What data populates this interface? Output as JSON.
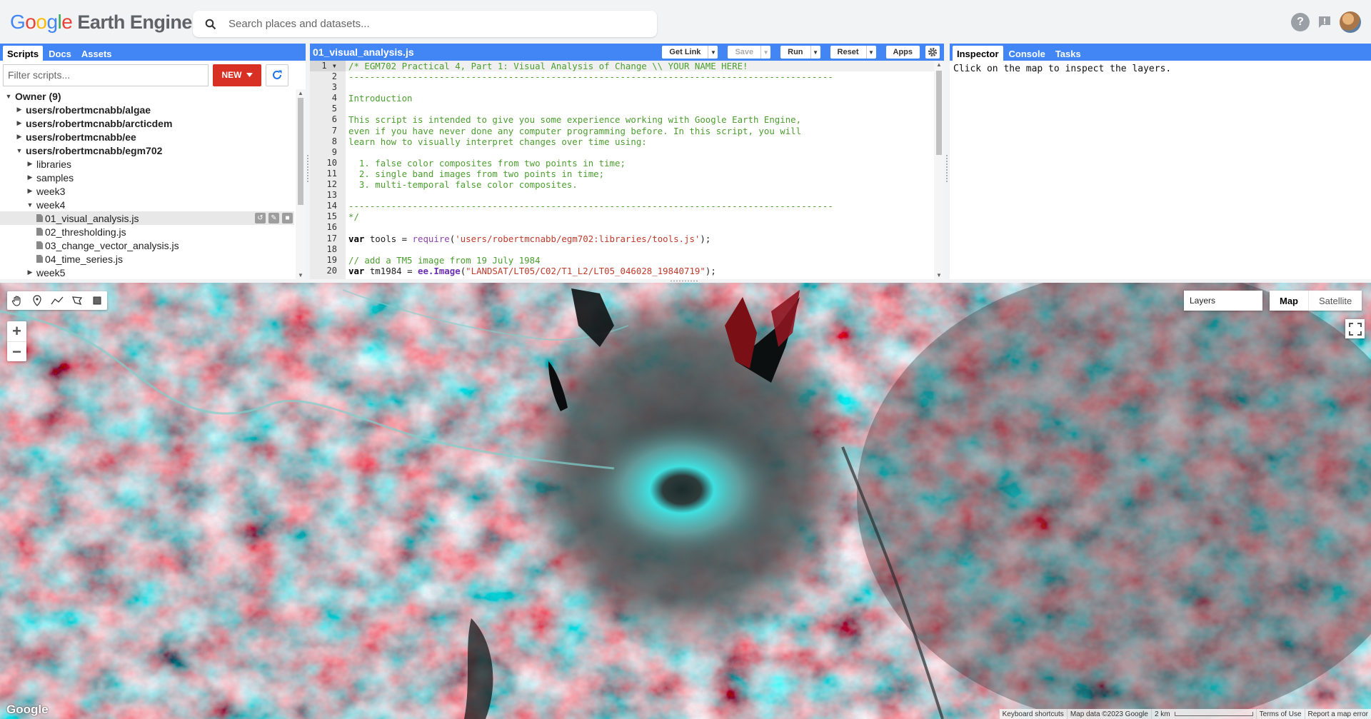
{
  "header": {
    "logo_letters": [
      "G",
      "o",
      "o",
      "g",
      "l",
      "e"
    ],
    "logo_product": "Earth Engine",
    "search_placeholder": "Search places and datasets..."
  },
  "left_panel": {
    "tabs": [
      {
        "label": "Scripts",
        "active": true
      },
      {
        "label": "Docs",
        "active": false
      },
      {
        "label": "Assets",
        "active": false
      }
    ],
    "filter_placeholder": "Filter scripts...",
    "new_label": "NEW",
    "tree": [
      {
        "label": "Owner (9)",
        "depth": 0,
        "expanded": true,
        "bold": true,
        "type": "folder"
      },
      {
        "label": "users/robertmcnabb/algae",
        "depth": 1,
        "expanded": false,
        "bold": true,
        "type": "folder"
      },
      {
        "label": "users/robertmcnabb/arcticdem",
        "depth": 1,
        "expanded": false,
        "bold": true,
        "type": "folder"
      },
      {
        "label": "users/robertmcnabb/ee",
        "depth": 1,
        "expanded": false,
        "bold": true,
        "type": "folder"
      },
      {
        "label": "users/robertmcnabb/egm702",
        "depth": 1,
        "expanded": true,
        "bold": true,
        "type": "folder"
      },
      {
        "label": "libraries",
        "depth": 2,
        "expanded": false,
        "bold": false,
        "type": "folder"
      },
      {
        "label": "samples",
        "depth": 2,
        "expanded": false,
        "bold": false,
        "type": "folder"
      },
      {
        "label": "week3",
        "depth": 2,
        "expanded": false,
        "bold": false,
        "type": "folder"
      },
      {
        "label": "week4",
        "depth": 2,
        "expanded": true,
        "bold": false,
        "type": "folder"
      },
      {
        "label": "01_visual_analysis.js",
        "depth": 3,
        "type": "file",
        "selected": true
      },
      {
        "label": "02_thresholding.js",
        "depth": 3,
        "type": "file"
      },
      {
        "label": "03_change_vector_analysis.js",
        "depth": 3,
        "type": "file"
      },
      {
        "label": "04_time_series.js",
        "depth": 3,
        "type": "file"
      },
      {
        "label": "week5",
        "depth": 2,
        "expanded": false,
        "bold": false,
        "type": "folder"
      }
    ]
  },
  "editor": {
    "title": "01_visual_analysis.js",
    "buttons": [
      {
        "label": "Get Link",
        "dropdown": true,
        "disabled": false
      },
      {
        "label": "Save",
        "dropdown": true,
        "disabled": true
      },
      {
        "label": "Run",
        "dropdown": true,
        "disabled": false
      },
      {
        "label": "Reset",
        "dropdown": true,
        "disabled": false
      },
      {
        "label": "Apps",
        "dropdown": false,
        "disabled": false
      }
    ],
    "lines": [
      [
        [
          "cm",
          "/* EGM702 Practical 4, Part 1: Visual Analysis of Change \\\\ YOUR NAME HERE!"
        ]
      ],
      [
        [
          "cm",
          "-------------------------------------------------------------------------------------------"
        ]
      ],
      [],
      [
        [
          "cm",
          "Introduction"
        ]
      ],
      [],
      [
        [
          "cm",
          "This script is intended to give you some experience working with Google Earth Engine,"
        ]
      ],
      [
        [
          "cm",
          "even if you have never done any computer programming before. In this script, you will"
        ]
      ],
      [
        [
          "cm",
          "learn how to visually interpret changes over time using:"
        ]
      ],
      [],
      [
        [
          "cm",
          "  1. false color composites from two points in time;"
        ]
      ],
      [
        [
          "cm",
          "  2. single band images from two points in time;"
        ]
      ],
      [
        [
          "cm",
          "  3. multi-temporal false color composites."
        ]
      ],
      [],
      [
        [
          "cm",
          "-------------------------------------------------------------------------------------------"
        ]
      ],
      [
        [
          "cm",
          "*/"
        ]
      ],
      [],
      [
        [
          "kw",
          "var"
        ],
        [
          "tx",
          " tools = "
        ],
        [
          "fn",
          "require"
        ],
        [
          "tx",
          "("
        ],
        [
          "str",
          "'users/robertmcnabb/egm702:libraries/tools.js'"
        ],
        [
          "tx",
          ");"
        ]
      ],
      [],
      [
        [
          "cm",
          "// add a TM5 image from 19 July 1984"
        ]
      ],
      [
        [
          "kw",
          "var"
        ],
        [
          "tx",
          " tm1984 = "
        ],
        [
          "ee",
          "ee.Image"
        ],
        [
          "tx",
          "("
        ],
        [
          "str",
          "\"LANDSAT/LT05/C02/T1_L2/LT05_046028_19840719\""
        ],
        [
          "tx",
          ");"
        ]
      ]
    ]
  },
  "right_panel": {
    "tabs": [
      {
        "label": "Inspector",
        "active": true
      },
      {
        "label": "Console",
        "active": false
      },
      {
        "label": "Tasks",
        "active": false
      }
    ],
    "message": "Click on the map to inspect the layers."
  },
  "map": {
    "zoom_in": "+",
    "zoom_out": "−",
    "layers_label": "Layers",
    "map_types": [
      {
        "label": "Map",
        "active": true
      },
      {
        "label": "Satellite",
        "active": false
      }
    ],
    "google_mark": "Google",
    "attribution": [
      "Keyboard shortcuts",
      "Map data ©2023 Google",
      "2 km",
      "Terms of Use",
      "Report a map error"
    ]
  }
}
